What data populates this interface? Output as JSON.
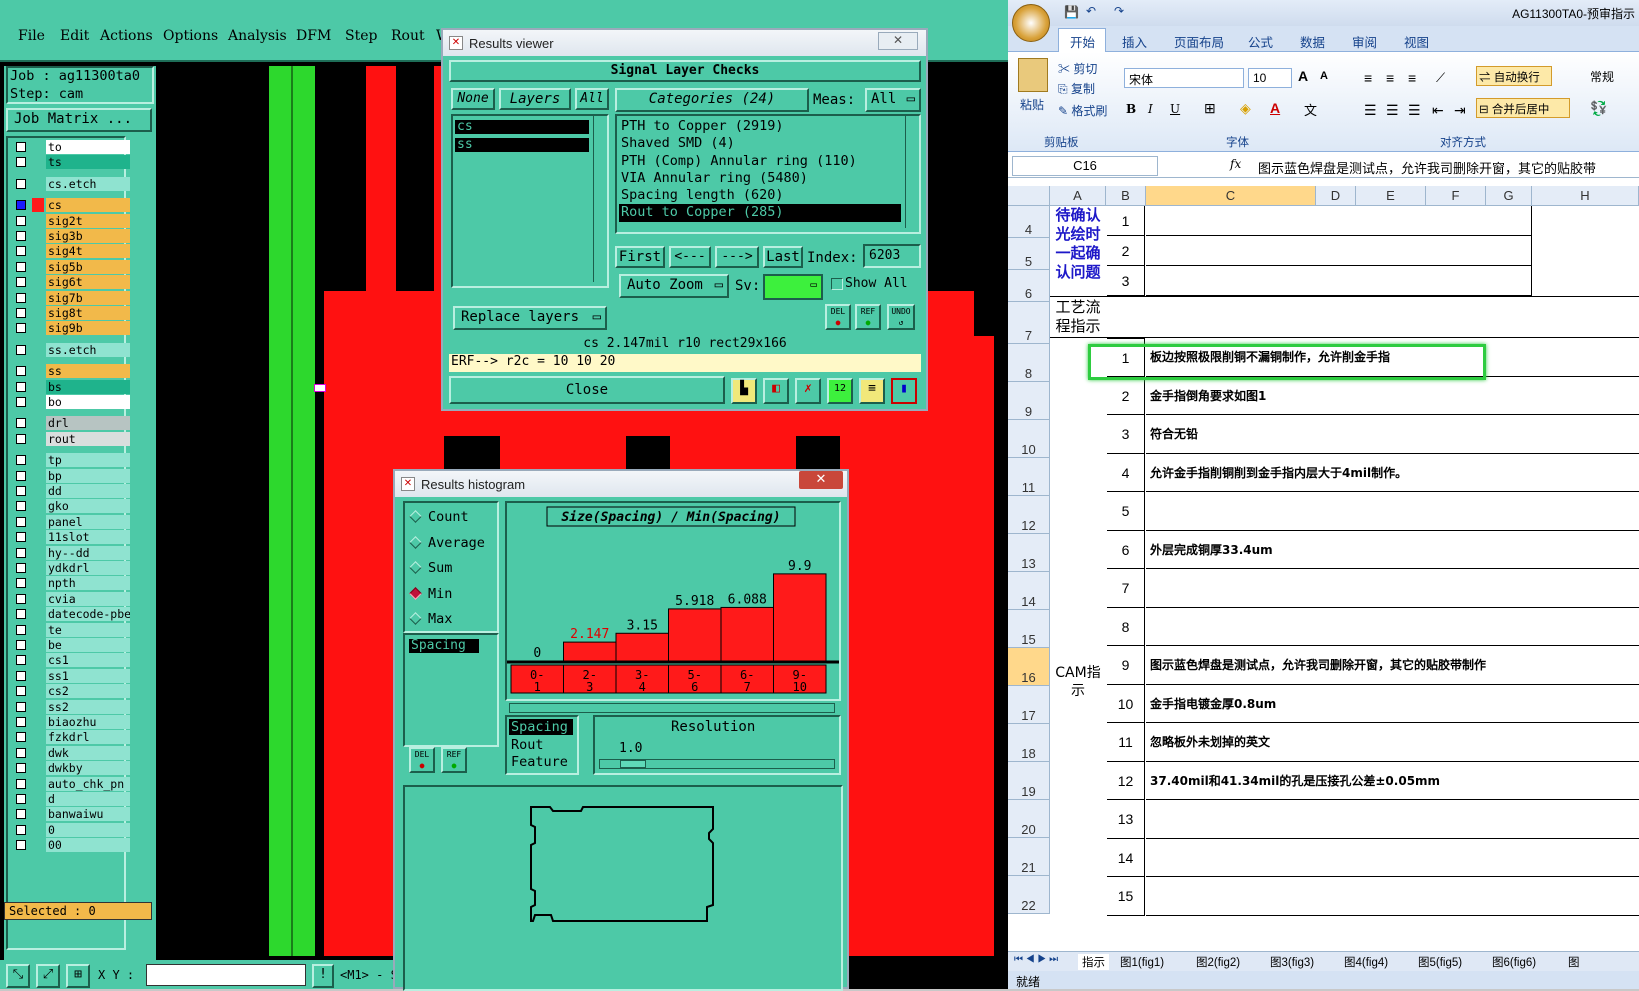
{
  "cam": {
    "menu": [
      "File",
      "Edit",
      "Actions",
      "Options",
      "Analysis",
      "DFM",
      "Step",
      "Rout",
      "Wi"
    ],
    "job": "Job : ag11300ta0",
    "step": "Step: cam",
    "job_matrix": "Job Matrix ...",
    "layers": [
      {
        "name": "to",
        "color": "#ffffff",
        "active": false
      },
      {
        "name": "ts",
        "color": "#1fb38c",
        "active": false
      },
      {
        "name": "cs.etch",
        "color": "#8fe3d0",
        "active": false
      },
      {
        "name": "cs",
        "color": "#f2b94a",
        "active": true
      },
      {
        "name": "sig2t",
        "color": "#f2b94a",
        "active": false
      },
      {
        "name": "sig3b",
        "color": "#f2b94a",
        "active": false
      },
      {
        "name": "sig4t",
        "color": "#f2b94a",
        "active": false
      },
      {
        "name": "sig5b",
        "color": "#f2b94a",
        "active": false
      },
      {
        "name": "sig6t",
        "color": "#f2b94a",
        "active": false
      },
      {
        "name": "sig7b",
        "color": "#f2b94a",
        "active": false
      },
      {
        "name": "sig8t",
        "color": "#f2b94a",
        "active": false
      },
      {
        "name": "sig9b",
        "color": "#f2b94a",
        "active": false
      },
      {
        "name": "ss.etch",
        "color": "#8fe3d0",
        "active": false
      },
      {
        "name": "ss",
        "color": "#f2b94a",
        "active": false
      },
      {
        "name": "bs",
        "color": "#1fb38c",
        "active": false
      },
      {
        "name": "bo",
        "color": "#ffffff",
        "active": false
      },
      {
        "name": "drl",
        "color": "#b7c4c2",
        "active": false
      },
      {
        "name": "rout",
        "color": "#d9dedd",
        "active": false
      },
      {
        "name": "tp",
        "color": "#8fe3d0",
        "active": false
      },
      {
        "name": "bp",
        "color": "#8fe3d0",
        "active": false
      },
      {
        "name": "dd",
        "color": "#8fe3d0",
        "active": false
      },
      {
        "name": "gko",
        "color": "#8fe3d0",
        "active": false
      },
      {
        "name": "panel",
        "color": "#8fe3d0",
        "active": false
      },
      {
        "name": "11slot",
        "color": "#8fe3d0",
        "active": false
      },
      {
        "name": "hy--dd",
        "color": "#8fe3d0",
        "active": false
      },
      {
        "name": "ydkdrl",
        "color": "#8fe3d0",
        "active": false
      },
      {
        "name": "npth",
        "color": "#8fe3d0",
        "active": false
      },
      {
        "name": "cvia",
        "color": "#8fe3d0",
        "active": false
      },
      {
        "name": "datecode-pbe",
        "color": "#8fe3d0",
        "active": false
      },
      {
        "name": "te",
        "color": "#8fe3d0",
        "active": false
      },
      {
        "name": "be",
        "color": "#8fe3d0",
        "active": false
      },
      {
        "name": "cs1",
        "color": "#8fe3d0",
        "active": false
      },
      {
        "name": "ss1",
        "color": "#8fe3d0",
        "active": false
      },
      {
        "name": "cs2",
        "color": "#8fe3d0",
        "active": false
      },
      {
        "name": "ss2",
        "color": "#8fe3d0",
        "active": false
      },
      {
        "name": "biaozhu",
        "color": "#8fe3d0",
        "active": false
      },
      {
        "name": "fzkdrl",
        "color": "#8fe3d0",
        "active": false
      },
      {
        "name": "dwk",
        "color": "#8fe3d0",
        "active": false
      },
      {
        "name": "dwkby",
        "color": "#8fe3d0",
        "active": false
      },
      {
        "name": "auto_chk_pn",
        "color": "#8fe3d0",
        "active": false
      },
      {
        "name": "d",
        "color": "#8fe3d0",
        "active": false
      },
      {
        "name": "banwaiwu",
        "color": "#8fe3d0",
        "active": false
      },
      {
        "name": "0",
        "color": "#8fe3d0",
        "active": false
      },
      {
        "name": "00",
        "color": "#8fe3d0",
        "active": false
      }
    ],
    "selected": "Selected : 0",
    "xy_label": "X Y :",
    "status_frag": "<M1> - S"
  },
  "results_viewer": {
    "title": "Results viewer",
    "header": "Signal Layer Checks",
    "none": "None",
    "layers": "Layers",
    "all": "All",
    "categories": "Categories (24)",
    "meas_label": "Meas:",
    "meas_value": "All",
    "layer_items": [
      "cs",
      "ss"
    ],
    "category_items": [
      "PTH to Copper (2919)",
      "Shaved SMD (4)",
      "PTH (Comp) Annular ring (110)",
      "VIA Annular ring (5480)",
      "Spacing length (620)",
      "Rout to Copper (285)"
    ],
    "first": "First",
    "prev": "<---",
    "next": "--->",
    "last": "Last",
    "index_label": "Index:",
    "index_value": "6203",
    "auto_zoom": "Auto Zoom",
    "sv_label": "Sv:",
    "show_all": "Show All",
    "replace_layers": "Replace layers",
    "del": "DEL",
    "ref": "REF",
    "undo": "UNDO",
    "status": "cs 2.147mil  r10  rect29x166",
    "erf": "ERF--> r2c = 10 10 20",
    "close": "Close"
  },
  "histogram": {
    "title": "Results histogram",
    "options": [
      "Count",
      "Average",
      "Sum",
      "Min",
      "Max"
    ],
    "selected_option": "Min",
    "list_item": "Spacing",
    "del": "DEL",
    "ref": "REF",
    "res_items": [
      "Spacing",
      "Rout",
      "Feature"
    ],
    "resolution_label": "Resolution",
    "resolution_value": "1.0"
  },
  "chart_data": {
    "type": "bar",
    "title": "Size(Spacing) / Min(Spacing)",
    "categories": [
      "0-1",
      "2-3",
      "3-4",
      "5-6",
      "6-7",
      "9-10"
    ],
    "values": [
      0,
      2.147,
      3.15,
      5.918,
      6.088,
      9.9
    ],
    "value_labels": [
      "0",
      "2.147",
      "3.15",
      "5.918",
      "6.088",
      "9.9"
    ],
    "highlight_index": 1,
    "bar_color": "#ff1a1a",
    "ylim": [
      0,
      10
    ]
  },
  "excel": {
    "title": "AG11300TA0-预审指示",
    "tabs": [
      "开始",
      "插入",
      "页面布局",
      "公式",
      "数据",
      "审阅",
      "视图"
    ],
    "clipboard": {
      "paste": "粘贴",
      "cut": "剪切",
      "copy": "复制",
      "format": "格式刷",
      "group": "剪贴板"
    },
    "font": {
      "name": "宋体",
      "size": "10",
      "group": "字体",
      "bold": "B",
      "italic": "I",
      "underline": "U",
      "grow": "A",
      "shrink": "A",
      "fontcolor": "A",
      "phonetic": "文"
    },
    "align": {
      "wrap": "自动换行",
      "merge": "合并后居中",
      "group": "对齐方式"
    },
    "number": {
      "general": "常规"
    },
    "namebox": "C16",
    "fx": "fx",
    "formula": "图示蓝色焊盘是测试点，允许我司删除开窗，其它的贴胶带",
    "col_headers": [
      "A",
      "B",
      "C",
      "D",
      "E",
      "F",
      "G",
      "H"
    ],
    "merged_a1": "待确认光绘时一起确认问题",
    "merged_a2": "工艺流程指示",
    "merged_a3": "CAM指示",
    "row_numbers": [
      "4",
      "5",
      "6",
      "7",
      "8",
      "9",
      "10",
      "11",
      "12",
      "13",
      "14",
      "15",
      "16",
      "17",
      "18",
      "19",
      "20",
      "21",
      "22"
    ],
    "top_nums": [
      "1",
      "2",
      "3"
    ],
    "rows": [
      {
        "n": "1",
        "text": "板边按照极限削铜不漏铜制作，允许削金手指"
      },
      {
        "n": "2",
        "text": "金手指倒角要求如图1"
      },
      {
        "n": "3",
        "text": "符合无铅"
      },
      {
        "n": "4",
        "text": "允许金手指削铜削到金手指内层大于4mil制作。"
      },
      {
        "n": "5",
        "text": ""
      },
      {
        "n": "6",
        "text": "外层完成铜厚33.4um"
      },
      {
        "n": "7",
        "text": ""
      },
      {
        "n": "8",
        "text": ""
      },
      {
        "n": "9",
        "text": "图示蓝色焊盘是测试点，允许我司删除开窗，其它的贴胶带制作"
      },
      {
        "n": "10",
        "text": "金手指电镀金厚0.8um"
      },
      {
        "n": "11",
        "text": "忽略板外未划掉的英文"
      },
      {
        "n": "12",
        "text": "37.40mil和41.34mil的孔是压接孔公差±0.05mm"
      },
      {
        "n": "13",
        "text": ""
      },
      {
        "n": "14",
        "text": ""
      },
      {
        "n": "15",
        "text": ""
      }
    ],
    "sheet_tabs": [
      "指示",
      "图1(fig1)",
      "图2(fig2)",
      "图3(fig3)",
      "图4(fig4)",
      "图5(fig5)",
      "图6(fig6)",
      "图"
    ],
    "status": "就绪"
  }
}
